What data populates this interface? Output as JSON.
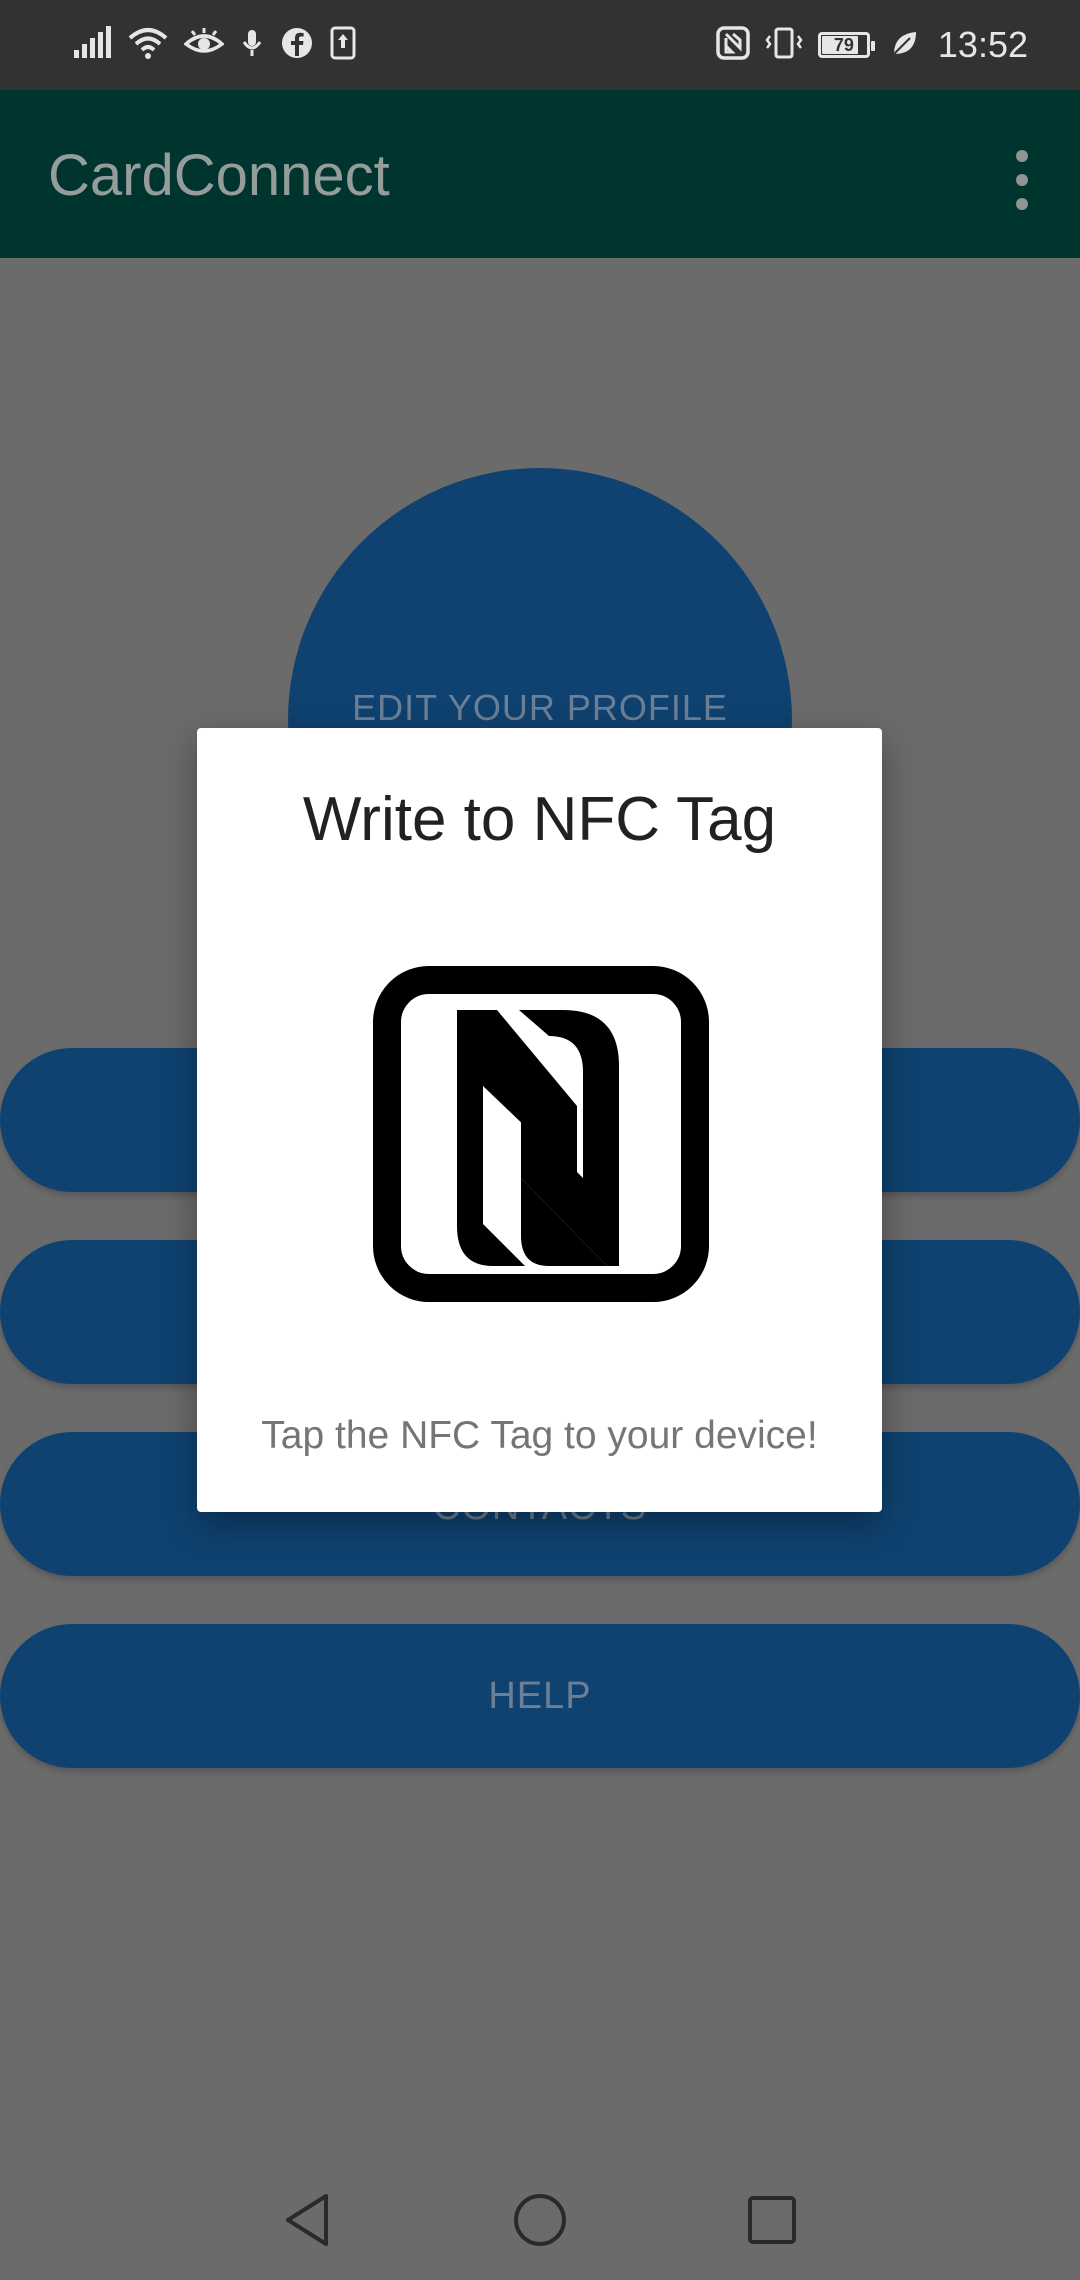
{
  "status_bar": {
    "time": "13:52",
    "battery_level": "79",
    "left_icons": [
      "signal-icon",
      "wifi-icon",
      "eye-comfort-icon",
      "microphone-icon",
      "facebook-icon",
      "upload-icon"
    ],
    "right_icons": [
      "nfc-status-icon",
      "vibrate-icon",
      "battery-icon",
      "leaf-icon"
    ]
  },
  "app_bar": {
    "title": "CardConnect",
    "menu_icon": "more-vert-icon"
  },
  "main": {
    "profile_button_label": "EDIT YOUR PROFILE",
    "buttons": [
      {
        "label": ""
      },
      {
        "label": ""
      },
      {
        "label": "CONTACTS"
      },
      {
        "label": "HELP"
      }
    ]
  },
  "dialog": {
    "title": "Write to NFC Tag",
    "icon": "nfc-icon",
    "message": "Tap the NFC Tag to your device!"
  },
  "nav_bar": {
    "buttons": [
      "back-icon",
      "home-icon",
      "recents-icon"
    ]
  },
  "colors": {
    "app_bar": "#00342e",
    "primary_button": "#0f4270",
    "scrim_background": "#6b6b6b",
    "dialog_background": "#ffffff"
  }
}
